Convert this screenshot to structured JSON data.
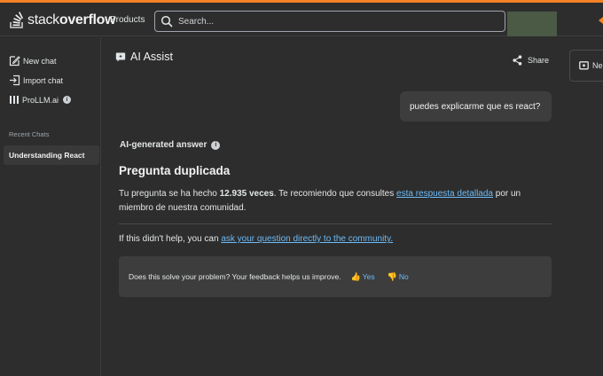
{
  "header": {
    "logo_text_light": "stack",
    "logo_text_bold": "overflow",
    "products_label": "Products",
    "search_placeholder": "Search..."
  },
  "sidebar": {
    "new_chat": "New chat",
    "import_chat": "Import chat",
    "prollm": "ProLLM.ai",
    "recent_label": "Recent Chats",
    "recent_items": [
      "Understanding React"
    ]
  },
  "main": {
    "title": "AI Assist",
    "share_label": "Share",
    "right_panel_label": "Ne",
    "user_message": "puedes explicarme que es react?",
    "ai_label": "AI-generated answer",
    "answer_title": "Pregunta duplicada",
    "answer_text_1": "Tu pregunta se ha hecho ",
    "answer_count": "12.935 veces",
    "answer_text_2": ". Te recomiendo que consultes ",
    "answer_link": "esta respuesta detallada",
    "answer_text_3": " por un miembro de nuestra comunidad.",
    "help_text": "If this didn't help, you can ",
    "help_link": "ask your question directly to the community.",
    "feedback_question": "Does this solve your problem? Your feedback helps us improve.",
    "feedback_yes": "Yes",
    "feedback_no": "No"
  },
  "colors": {
    "accent": "#f48225",
    "link": "#6cbbf7",
    "background": "#2d2d2d"
  }
}
